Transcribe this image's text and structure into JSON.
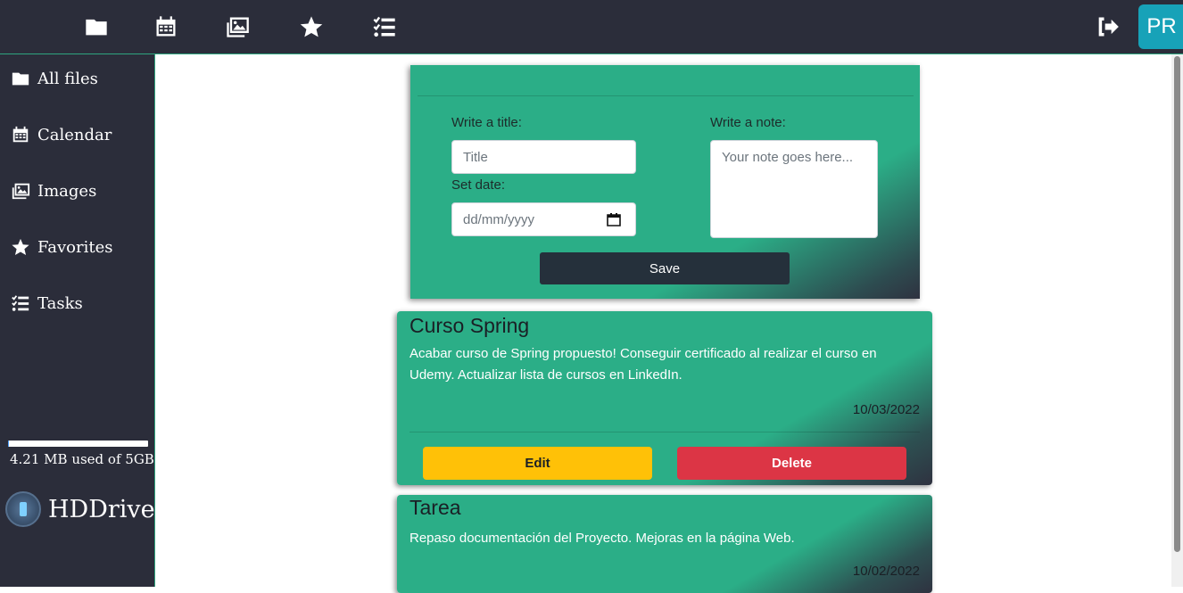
{
  "topbar": {
    "icons": [
      "folder-icon",
      "calendar-icon",
      "images-icon",
      "star-icon",
      "tasks-icon"
    ],
    "logout_icon": "sign-out-icon",
    "avatar_initials": "PR"
  },
  "sidebar": {
    "items": [
      {
        "label": "All files",
        "icon": "folder-icon"
      },
      {
        "label": "Calendar",
        "icon": "calendar-icon"
      },
      {
        "label": "Images",
        "icon": "images-icon"
      },
      {
        "label": "Favorites",
        "icon": "star-icon"
      },
      {
        "label": "Tasks",
        "icon": "tasks-icon"
      }
    ],
    "storage_text": "4.21 MB used of 5GB",
    "storage_fraction": 0.001,
    "brand_name": "HDDrive"
  },
  "form": {
    "title_label": "Write a title:",
    "title_placeholder": "Title",
    "date_label": "Set date:",
    "date_placeholder": "dd/mm/yyyy",
    "note_label": "Write a note:",
    "note_placeholder": "Your note goes here...",
    "save_label": "Save"
  },
  "notes": [
    {
      "title": "Curso Spring",
      "text": "Acabar curso de Spring propuesto! Conseguir certificado al realizar el curso en Udemy. Actualizar lista de cursos en LinkedIn.",
      "date": "10/03/2022",
      "edit_label": "Edit",
      "delete_label": "Delete"
    },
    {
      "title": "Tarea",
      "text": "Repaso documentación del Proyecto. Mejoras en la página Web.",
      "date": "10/02/2022"
    }
  ],
  "colors": {
    "bar_bg": "#2b2d3a",
    "card_green": "#2bae87",
    "edit_yellow": "#ffc107",
    "delete_red": "#dc3545",
    "avatar_teal": "#17a2b8"
  }
}
